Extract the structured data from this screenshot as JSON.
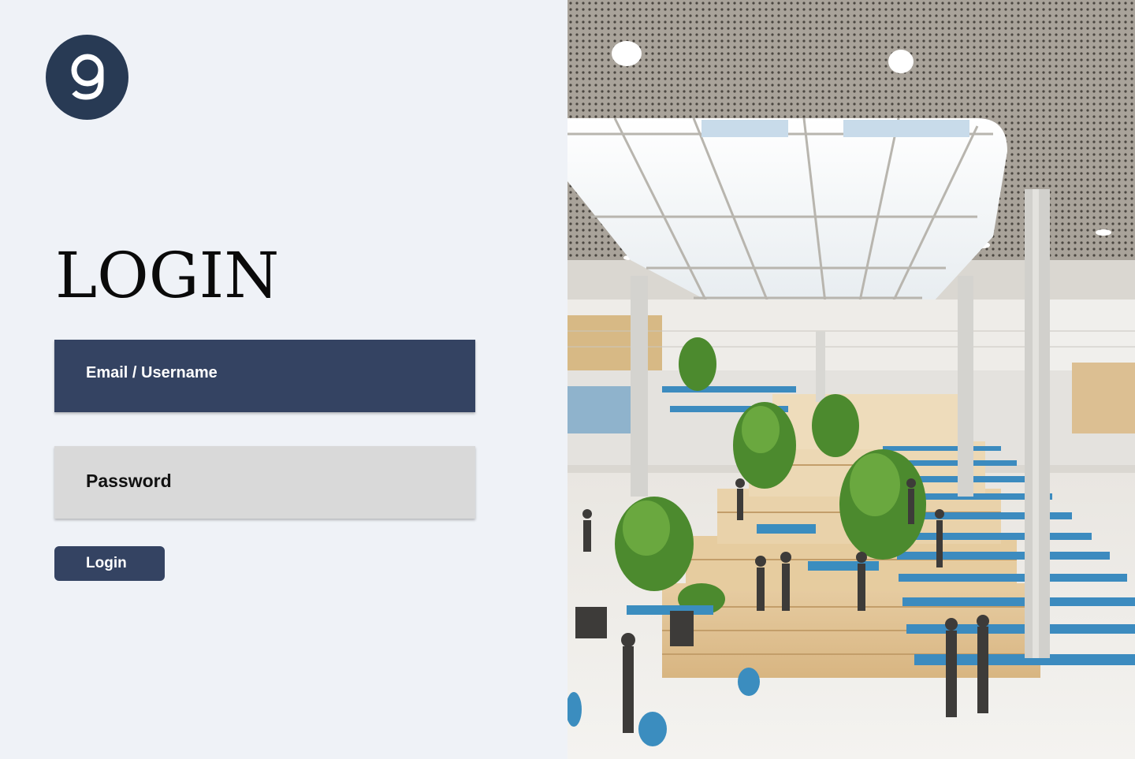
{
  "logo": {
    "glyph": "9",
    "icon": "brand-logo-icon",
    "background_color": "#283a54"
  },
  "login": {
    "title": "LOGIN",
    "email_placeholder": "Email / Username",
    "password_placeholder": "Password",
    "submit_label": "Login"
  },
  "colors": {
    "primary": "#344362",
    "page_background": "#eff2f7",
    "password_field": "#d9d9d9"
  },
  "hero": {
    "image": "atrium-interior-illustration"
  }
}
